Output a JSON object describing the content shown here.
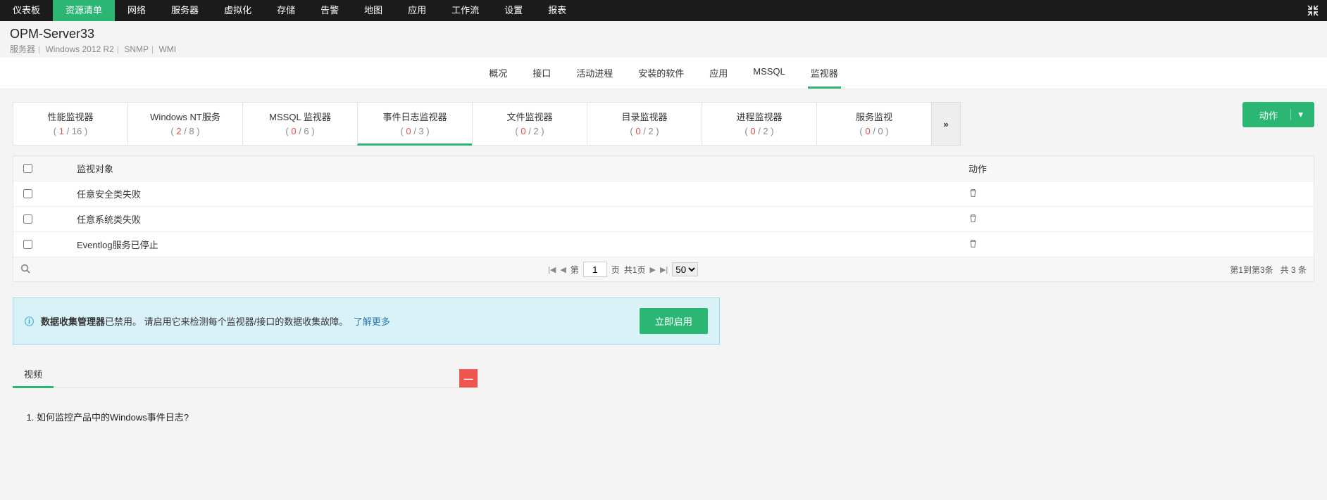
{
  "nav": {
    "items": [
      "仪表板",
      "资源清单",
      "网络",
      "服务器",
      "虚拟化",
      "存储",
      "告警",
      "地图",
      "应用",
      "工作流",
      "设置",
      "报表"
    ],
    "activeIndex": 1
  },
  "header": {
    "title": "OPM-Server33",
    "crumbs": [
      "服务器",
      "Windows 2012 R2",
      "SNMP",
      "WMI"
    ]
  },
  "subtabs": {
    "items": [
      "概况",
      "接口",
      "活动进程",
      "安装的软件",
      "应用",
      "MSSQL",
      "监视器"
    ],
    "activeIndex": 6
  },
  "monitors": {
    "tabs": [
      {
        "label": "性能监视器",
        "a": 1,
        "b": 16
      },
      {
        "label": "Windows NT服务",
        "a": 2,
        "b": 8
      },
      {
        "label": "MSSQL 监视器",
        "a": 0,
        "b": 6
      },
      {
        "label": "事件日志监视器",
        "a": 0,
        "b": 3
      },
      {
        "label": "文件监视器",
        "a": 0,
        "b": 2
      },
      {
        "label": "目录监视器",
        "a": 0,
        "b": 2
      },
      {
        "label": "进程监视器",
        "a": 0,
        "b": 2
      },
      {
        "label": "服务监视",
        "a": 0,
        "b": 0
      }
    ],
    "activeIndex": 3,
    "actionLabel": "动作"
  },
  "table": {
    "cols": {
      "name": "监视对象",
      "action": "动作"
    },
    "rows": [
      {
        "name": "任意安全类失败"
      },
      {
        "name": "任意系统类失败"
      },
      {
        "name": "Eventlog服务已停止"
      }
    ],
    "pager": {
      "prefix": "第",
      "pageInput": "1",
      "mid": "页",
      "total": "共1页",
      "perPage": "50",
      "right1": "第1到第3条",
      "right2": "共 3 条"
    }
  },
  "banner": {
    "strong": "数据收集管理器",
    "text": "已禁用。 请启用它来检测每个监视器/接口的数据收集故障。",
    "link": "了解更多",
    "button": "立即启用"
  },
  "video": {
    "tab": "视频",
    "item1": "如何监控产品中的Windows事件日志?",
    "close": "—"
  }
}
